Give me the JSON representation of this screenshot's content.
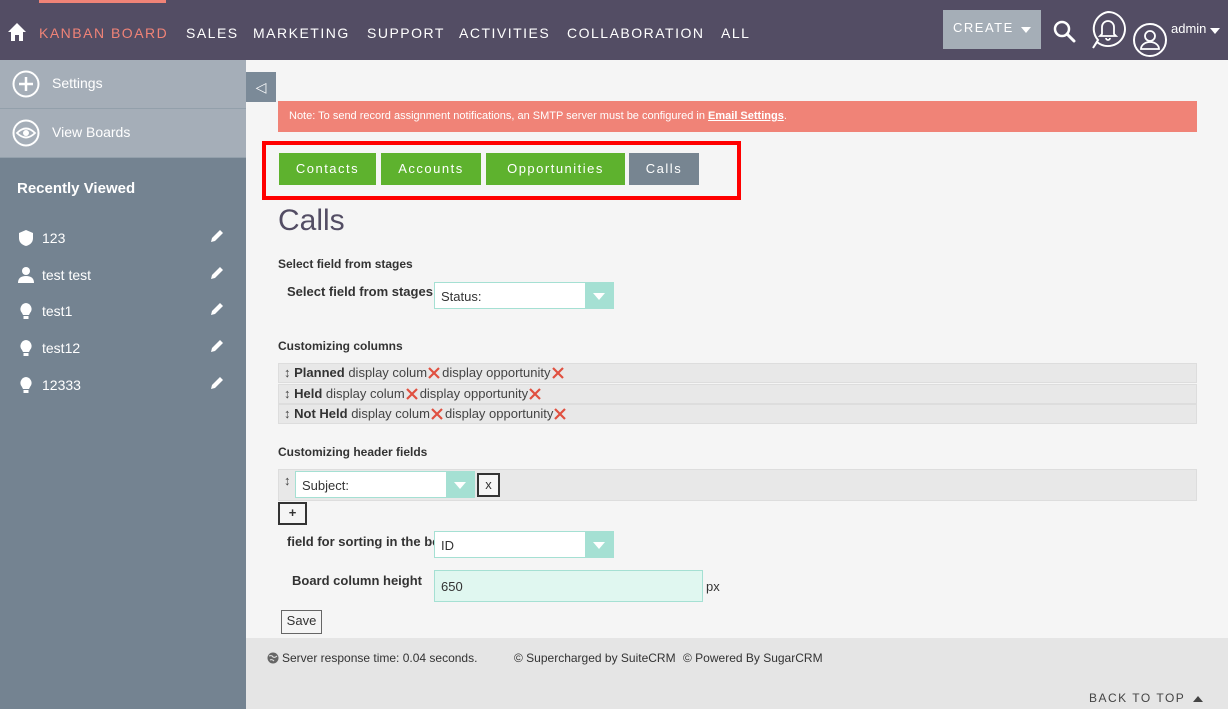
{
  "topnav": {
    "items": [
      "KANBAN BOARD",
      "SALES",
      "MARKETING",
      "SUPPORT",
      "ACTIVITIES",
      "COLLABORATION",
      "ALL"
    ],
    "create_label": "CREATE",
    "user_label": "admin",
    "active_color": "#f08377",
    "bg_color": "#534d64"
  },
  "sidebar": {
    "actions": [
      {
        "label": "Settings",
        "icon": "plus-icon"
      },
      {
        "label": "View Boards",
        "icon": "eye-icon"
      }
    ],
    "recent_title": "Recently Viewed",
    "recent": [
      {
        "label": "123",
        "icon": "shield-icon"
      },
      {
        "label": "test test",
        "icon": "person-icon"
      },
      {
        "label": "test1",
        "icon": "lightbulb-icon"
      },
      {
        "label": "test12",
        "icon": "lightbulb-icon"
      },
      {
        "label": "12333",
        "icon": "lightbulb-icon"
      }
    ]
  },
  "main": {
    "collapse_glyph": "◁",
    "note_text": "Note: To send record assignment notifications, an SMTP server must be configured in ",
    "note_link": "Email Settings",
    "note_end": ".",
    "tabs": [
      {
        "label": "Contacts",
        "active": false
      },
      {
        "label": "Accounts",
        "active": false
      },
      {
        "label": "Opportunities",
        "active": false
      },
      {
        "label": "Calls",
        "active": true
      }
    ],
    "page_title": "Calls",
    "stages_section": "Select field from stages",
    "stages_label": "Select field from stages",
    "stages_value": "Status:",
    "columns_section": "Customizing columns",
    "column_rows": [
      {
        "name": "Planned",
        "col_text": "display colum",
        "opp_text": "display opportunity"
      },
      {
        "name": "Held",
        "col_text": "display colum",
        "opp_text": "display opportunity"
      },
      {
        "name": "Not Held",
        "col_text": "display colum",
        "opp_text": "display opportunity"
      }
    ],
    "header_section": "Customizing header fields",
    "header_value": "Subject:",
    "remove_label": "x",
    "add_label": "+",
    "sort_label": "field for sorting in the board",
    "sort_value": "ID",
    "height_label": "Board column height",
    "height_value": "650",
    "height_unit": "px",
    "save_label": "Save"
  },
  "footer": {
    "response": "Server response time: 0.04 seconds.",
    "supercharged": "© Supercharged by SuiteCRM",
    "powered": "© Powered By SugarCRM",
    "back_top": "BACK TO TOP"
  }
}
